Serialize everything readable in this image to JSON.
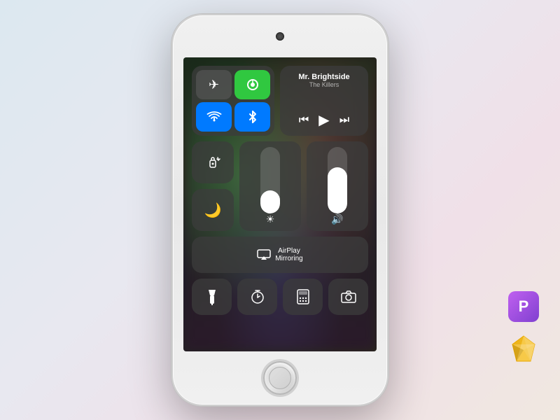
{
  "page": {
    "bg_gradient": "linear-gradient(135deg, #dce8f0, #e8e8f0, #f0e0e8)"
  },
  "phone": {
    "camera_label": "front camera"
  },
  "control_center": {
    "toggles": {
      "airplane": {
        "label": "Airplane Mode",
        "icon": "✈",
        "active": false
      },
      "wifi_hotspot": {
        "label": "Hotspot",
        "icon": "📶",
        "active": true,
        "color": "green"
      },
      "wifi": {
        "label": "Wi-Fi",
        "icon": "wifi",
        "active": true,
        "color": "blue"
      },
      "bluetooth": {
        "label": "Bluetooth",
        "icon": "bluetooth",
        "active": true,
        "color": "blue"
      }
    },
    "music": {
      "title": "Mr. Brightside",
      "artist": "The Killers",
      "prev_label": "⏮",
      "play_label": "▶",
      "next_label": "⏭"
    },
    "orientation_lock": {
      "label": "Orientation Lock",
      "icon": "🔒"
    },
    "do_not_disturb": {
      "label": "Do Not Disturb",
      "icon": "🌙"
    },
    "brightness": {
      "label": "Brightness",
      "value": 35,
      "icon": "☀"
    },
    "volume": {
      "label": "Volume",
      "value": 70,
      "icon": "🔊"
    },
    "airplay": {
      "label": "AirPlay Mirroring",
      "line1": "AirPlay",
      "line2": "Mirroring"
    },
    "flashlight": {
      "label": "Flashlight",
      "icon": "🔦"
    },
    "timer": {
      "label": "Timer",
      "icon": "⏱"
    },
    "calculator": {
      "label": "Calculator",
      "icon": "🔢"
    },
    "camera": {
      "label": "Camera",
      "icon": "📷"
    }
  },
  "brand_icons": {
    "pixelmator_label": "P",
    "sketch_label": "sketch"
  }
}
